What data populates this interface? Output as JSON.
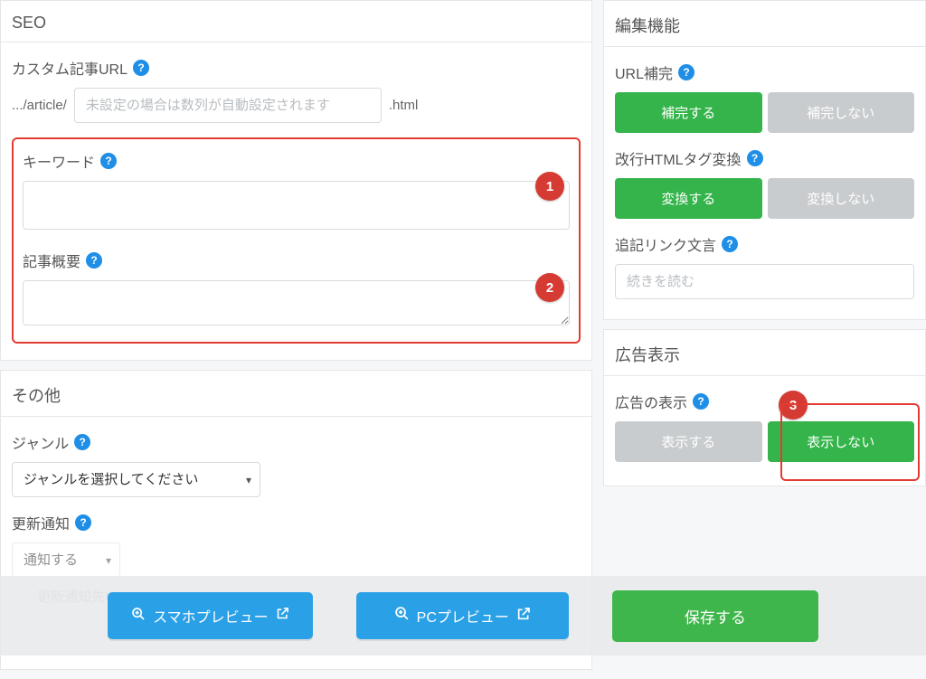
{
  "seo": {
    "title": "SEO",
    "custom_url_label": "カスタム記事URL",
    "url_prefix": ".../article/",
    "url_placeholder": "未設定の場合は数列が自動設定されます",
    "url_suffix": ".html",
    "keyword_label": "キーワード",
    "summary_label": "記事概要"
  },
  "other": {
    "title": "その他",
    "genre_label": "ジャンル",
    "genre_placeholder": "ジャンルを選択してください",
    "notify_label": "更新通知",
    "notify_value": "通知する",
    "notify_url_label": "更新通知先URL"
  },
  "edit": {
    "title": "編集機能",
    "url_completion_label": "URL補完",
    "complete_on": "補完する",
    "complete_off": "補完しない",
    "br_label": "改行HTMLタグ変換",
    "br_on": "変換する",
    "br_off": "変換しない",
    "more_label": "追記リンク文言",
    "more_placeholder": "続きを読む"
  },
  "ads": {
    "title": "広告表示",
    "display_label": "広告の表示",
    "show_on": "表示する",
    "show_off": "表示しない"
  },
  "footer": {
    "sp_preview": "スマホプレビュー",
    "pc_preview": "PCプレビュー",
    "save": "保存する"
  },
  "badges": {
    "one": "1",
    "two": "2",
    "three": "3"
  }
}
